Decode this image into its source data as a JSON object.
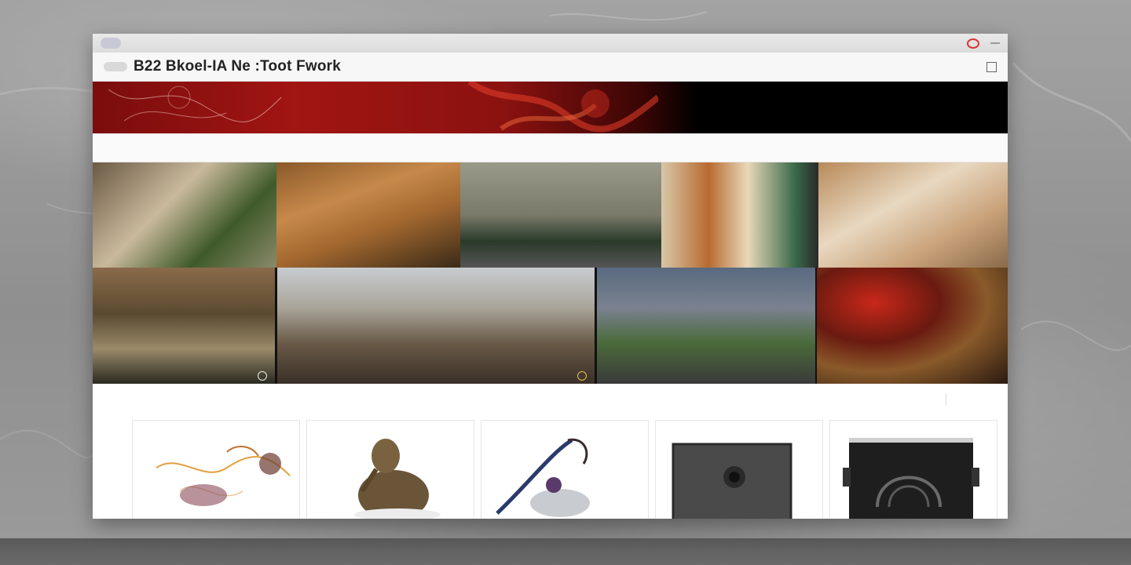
{
  "browser": {
    "tab_label": "",
    "right_items": [
      "",
      ""
    ]
  },
  "site": {
    "title": "B22 Bkoel-IA Ne :Toot Fwork",
    "tools_label": ""
  },
  "hero": {
    "left_links": [],
    "right_links": []
  },
  "filters": {
    "left": [],
    "right": []
  },
  "gallery": {
    "tiles": []
  },
  "collection": {
    "title": "",
    "sort_label": "",
    "view_label": "",
    "cards": [
      {
        "name": "wire-flower-sculpture"
      },
      {
        "name": "furred-figure-sculpture"
      },
      {
        "name": "bent-metal-sculpture"
      },
      {
        "name": "dark-stone-relief"
      },
      {
        "name": "carved-black-panel"
      }
    ]
  },
  "colors": {
    "accent_red": "#a11512",
    "hero_orange_link": "#e6a24a",
    "record_button": "#dd3333"
  }
}
